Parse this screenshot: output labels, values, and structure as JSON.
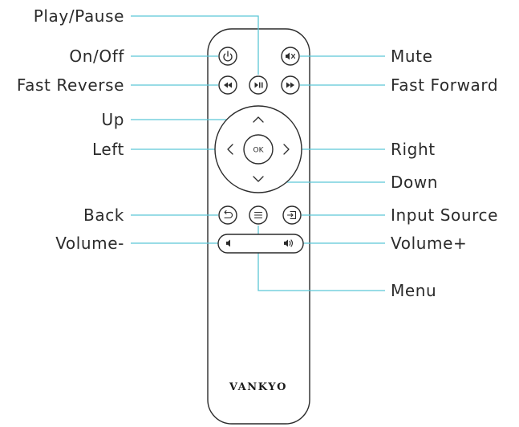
{
  "brand": "VANKYO",
  "ok_label": "OK",
  "labels": {
    "play_pause": "Play/Pause",
    "on_off": "On/Off",
    "mute": "Mute",
    "fast_reverse": "Fast Reverse",
    "fast_forward": "Fast Forward",
    "up": "Up",
    "left": "Left",
    "right": "Right",
    "down": "Down",
    "back": "Back",
    "input_source": "Input Source",
    "volume_minus": "Volume-",
    "volume_plus": "Volume+",
    "menu": "Menu"
  },
  "colors": {
    "leader_line": "#5cc7d6",
    "outline": "#2b2b2b",
    "text": "#2b2b2b",
    "background": "#ffffff"
  },
  "icons": [
    "power-icon",
    "play-pause-icon",
    "mute-icon",
    "rewind-icon",
    "fast-forward-icon",
    "chevron-up-icon",
    "chevron-left-icon",
    "chevron-right-icon",
    "chevron-down-icon",
    "back-icon",
    "menu-icon",
    "input-source-icon",
    "volume-down-icon",
    "volume-up-icon"
  ]
}
